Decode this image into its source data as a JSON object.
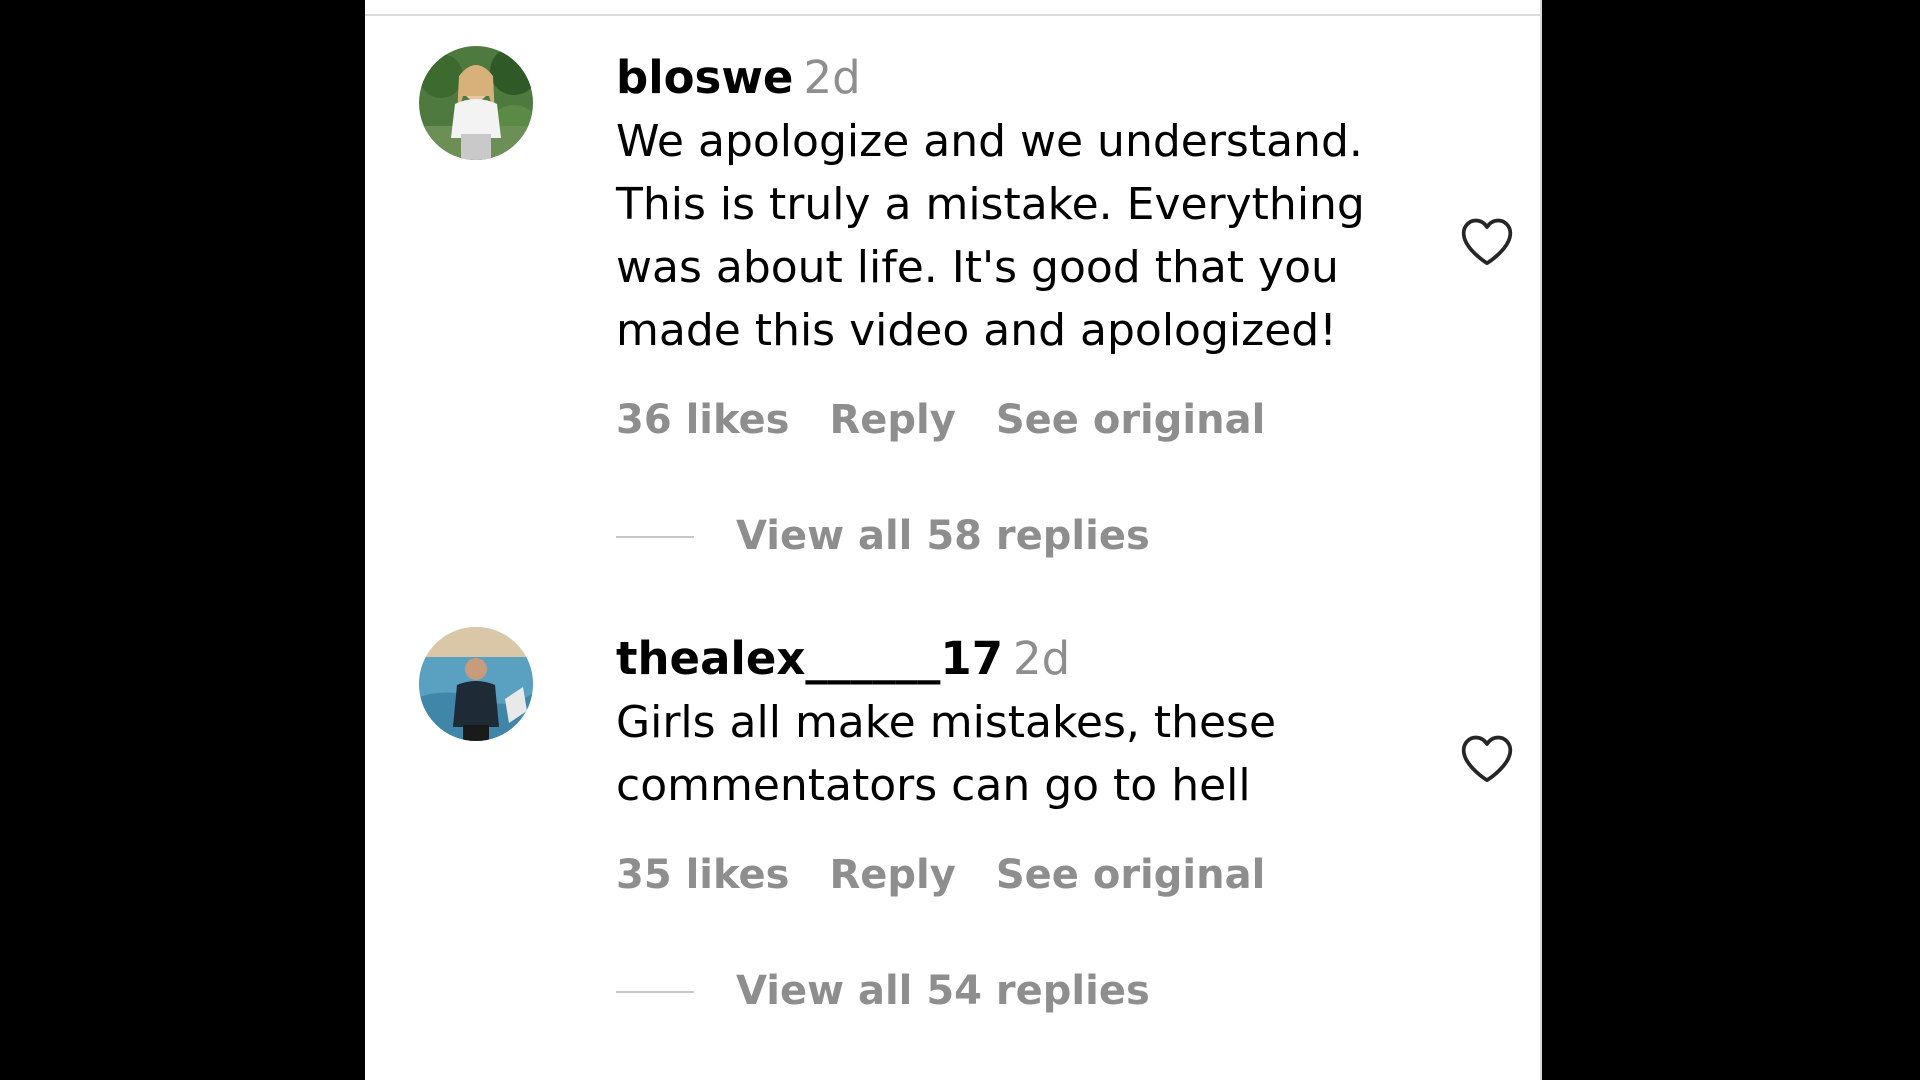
{
  "comments": [
    {
      "username": "bloswe",
      "timestamp": "2d",
      "text": "We apologize and we understand.\nThis is truly a mistake. Everything\nwas about life. It's good that you\nmade this video and apologized!",
      "likes": "36 likes",
      "reply_label": "Reply",
      "see_original_label": "See original",
      "view_replies_label": "View all 58 replies",
      "liked": false
    },
    {
      "username": "thealex______17",
      "timestamp": "2d",
      "text": "Girls all make mistakes, these\ncommentators can go to hell",
      "likes": "35 likes",
      "reply_label": "Reply",
      "see_original_label": "See original",
      "view_replies_label": "View all 54 replies",
      "liked": false
    }
  ],
  "icons": {
    "like": "heart-outline-icon"
  },
  "colors": {
    "primary_text": "#000000",
    "secondary_text": "#8e8e8e",
    "panel_background": "#ffffff",
    "outer_background": "#000000",
    "divider": "#dbdbdb"
  }
}
